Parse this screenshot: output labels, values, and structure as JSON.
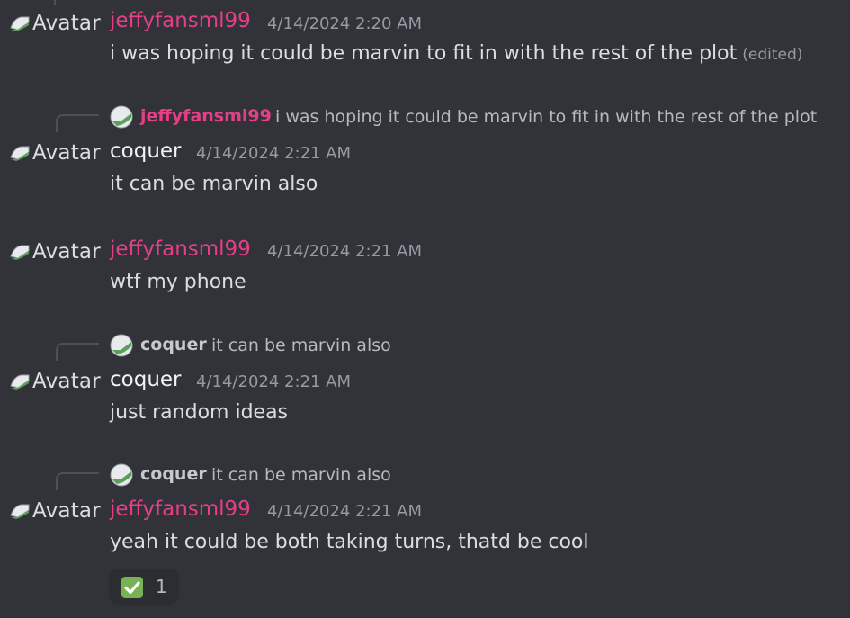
{
  "colors": {
    "background": "#313338",
    "jeffy_name": "#e63e87",
    "coquer_name": "#f2f3f5",
    "text": "#dbdee1",
    "muted": "#949ba4"
  },
  "avatar_alt": "Avatar",
  "messages": [
    {
      "author": "jeffyfansml99",
      "timestamp": "4/14/2024 2:20 AM",
      "content": "i was hoping it could be marvin to fit in with the rest of the plot",
      "edited": "(edited)"
    },
    {
      "reply_to": {
        "author": "jeffyfansml99",
        "text": "i was hoping it could be marvin to fit in with the rest of the plot"
      },
      "author": "coquer",
      "timestamp": "4/14/2024 2:21 AM",
      "content": "it can be marvin also"
    },
    {
      "author": "jeffyfansml99",
      "timestamp": "4/14/2024 2:21 AM",
      "content": "wtf my phone"
    },
    {
      "reply_to": {
        "author": "coquer",
        "text": "it can be marvin also"
      },
      "author": "coquer",
      "timestamp": "4/14/2024 2:21 AM",
      "content": "just random ideas"
    },
    {
      "reply_to": {
        "author": "coquer",
        "text": "it can be marvin also"
      },
      "author": "jeffyfansml99",
      "timestamp": "4/14/2024 2:21 AM",
      "content": "yeah it could be both taking turns, thatd be cool",
      "reactions": [
        {
          "emoji": "check-mark-button",
          "count": "1"
        }
      ]
    }
  ]
}
